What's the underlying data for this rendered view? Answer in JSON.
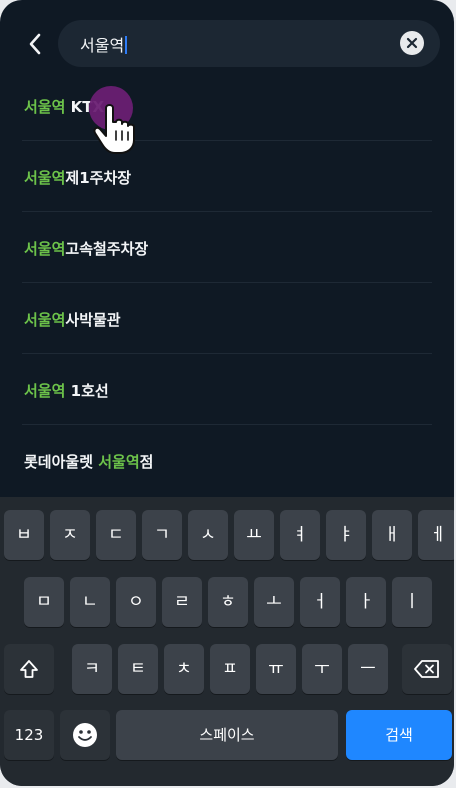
{
  "search": {
    "query": "서울역"
  },
  "results": [
    {
      "highlight": "서울역",
      "rest": " KTX",
      "prefix": ""
    },
    {
      "highlight": "서울역",
      "rest": "제1주차장",
      "prefix": ""
    },
    {
      "highlight": "서울역",
      "rest": "고속철주차장",
      "prefix": ""
    },
    {
      "highlight": "서울역",
      "rest": "사박물관",
      "prefix": ""
    },
    {
      "highlight": "서울역",
      "rest": " 1호선",
      "prefix": ""
    },
    {
      "highlight": "서울역",
      "rest": "점",
      "prefix": "롯데아울렛 "
    }
  ],
  "keyboard": {
    "row1": [
      "ㅂ",
      "ㅈ",
      "ㄷ",
      "ㄱ",
      "ㅅ",
      "ㅛ",
      "ㅕ",
      "ㅑ",
      "ㅐ",
      "ㅔ"
    ],
    "row2": [
      "ㅁ",
      "ㄴ",
      "ㅇ",
      "ㄹ",
      "ㅎ",
      "ㅗ",
      "ㅓ",
      "ㅏ",
      "ㅣ"
    ],
    "row3": [
      "ㅋ",
      "ㅌ",
      "ㅊ",
      "ㅍ",
      "ㅠ",
      "ㅜ",
      "ㅡ"
    ],
    "numbers_label": "123",
    "space_label": "스페이스",
    "search_label": "검색"
  },
  "colors": {
    "background": "#0f1924",
    "highlight": "#6cc24a",
    "search_key": "#1f87ff",
    "key": "#3c424a"
  }
}
